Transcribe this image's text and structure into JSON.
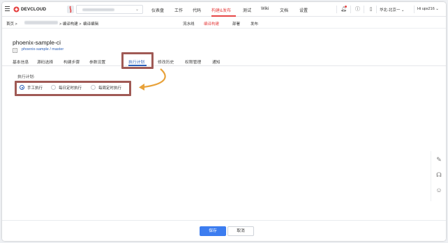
{
  "brand": {
    "logo_text": "DEVCLOUD",
    "accent": "#e64545",
    "link_color": "#2b5fb8"
  },
  "topnav": {
    "items": [
      "仪表盘",
      "工作",
      "代码",
      "构建&发布",
      "测试",
      "Wiki",
      "文档",
      "设置"
    ],
    "active_index": 3
  },
  "topbar_right": {
    "region": "华北-北京一 ⌄",
    "user": "Hi ups216 ⌄"
  },
  "breadcrumb": {
    "home": "首页 >",
    "build": "> 编译构建 >",
    "edit": "编译编辑"
  },
  "subnav": {
    "items": [
      "流水线",
      "编译构建",
      "部署",
      "发布"
    ],
    "active_index": 1
  },
  "header": {
    "title": "phoenix-sample-ci",
    "repo": "phoenix-sample / master"
  },
  "tabs": {
    "items": [
      "基本信息",
      "源码选择",
      "构建步骤",
      "参数设置",
      "执行计划",
      "修改历史",
      "权限管理",
      "通知"
    ],
    "active_index": 4
  },
  "exec_plan": {
    "label": "执行计划:",
    "options": [
      "手工执行",
      "每日定时执行",
      "每周定时执行"
    ],
    "selected_index": 0
  },
  "footer": {
    "save_label": "保存",
    "cancel_label": "取消"
  }
}
